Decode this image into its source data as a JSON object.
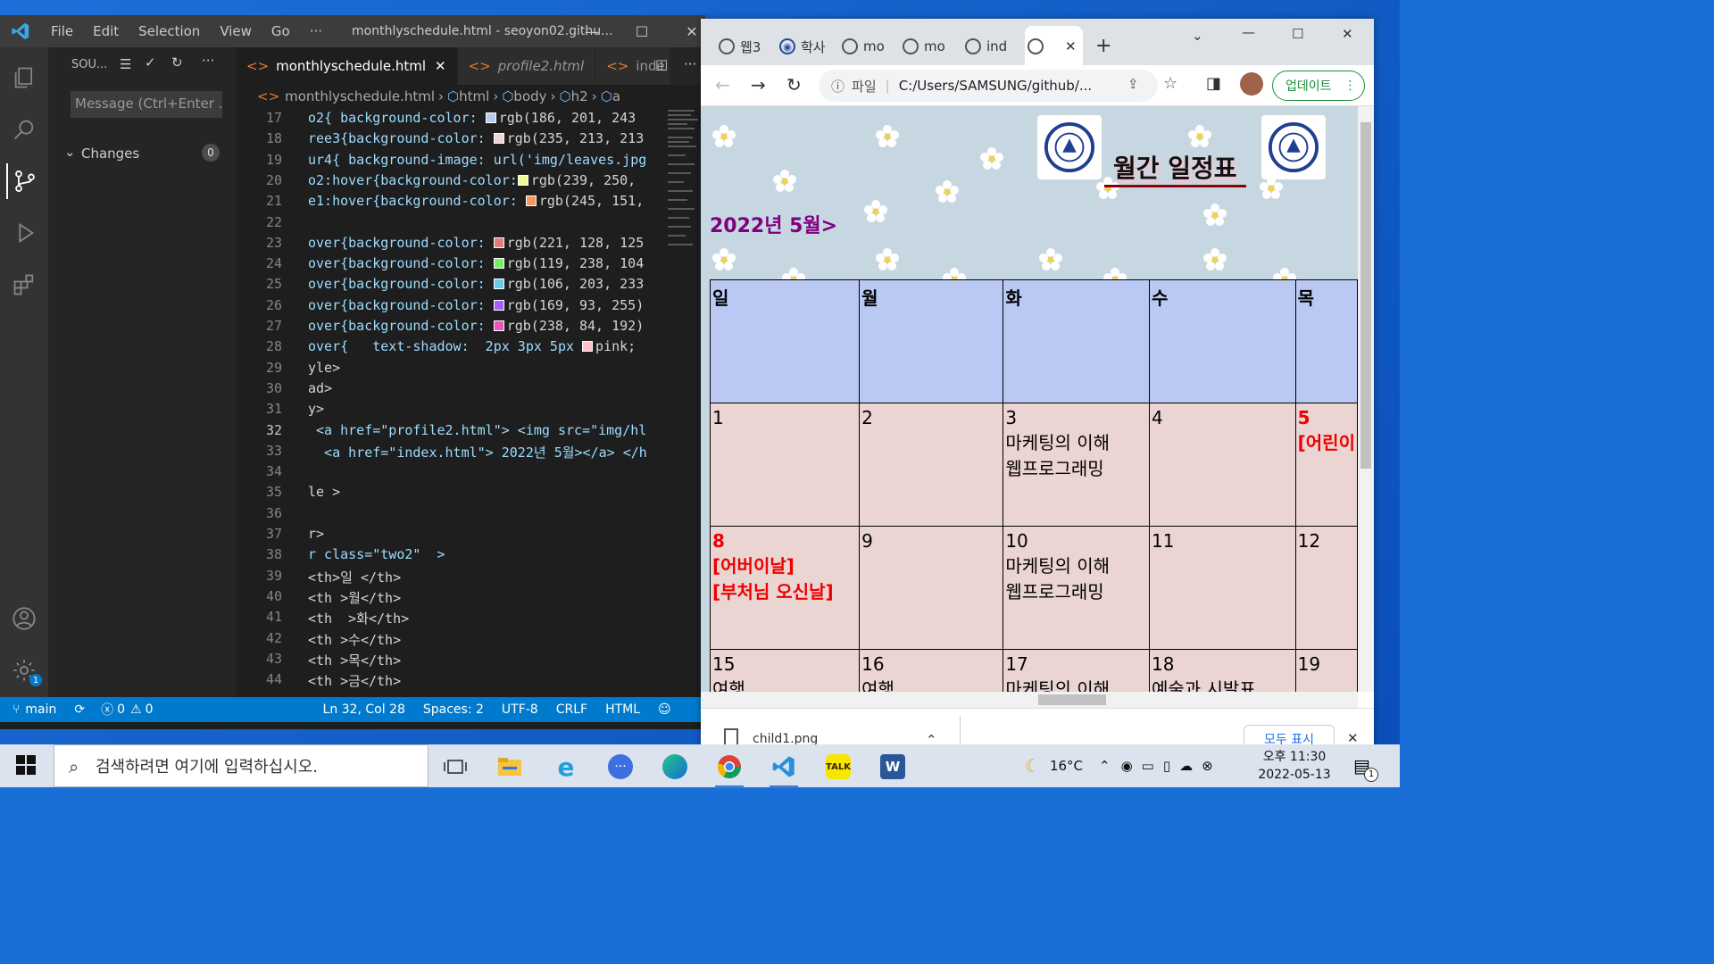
{
  "vscode": {
    "menu": [
      "File",
      "Edit",
      "Selection",
      "View",
      "Go",
      "···"
    ],
    "window_title": "monthlyschedule.html - seoyon02.githu...",
    "sidebar": {
      "header": "SOU...",
      "message_placeholder": "Message (Ctrl+Enter ...",
      "changes_label": "Changes",
      "changes_count": "0"
    },
    "tabs": [
      "monthlyschedule.html",
      "profile2.html",
      "inde"
    ],
    "breadcrumb": [
      "monthlyschedule.html",
      "html",
      "body",
      "h2",
      "a"
    ],
    "code_lines": [
      {
        "n": "17",
        "pre": "o2{ background-color: ",
        "swatch": "#bac9f3",
        "post": "rgb(186, 201, 243"
      },
      {
        "n": "18",
        "pre": "ree3{background-color: ",
        "swatch": "#ebd5d5",
        "post": "rgb(235, 213, 213"
      },
      {
        "n": "19",
        "pre": "ur4{ background-image: url('img/leaves.jpg",
        "swatch": "",
        "post": ""
      },
      {
        "n": "20",
        "pre": "o2:hover{background-color:",
        "swatch": "#effa9a",
        "post": "rgb(239, 250,"
      },
      {
        "n": "21",
        "pre": "e1:hover{background-color: ",
        "swatch": "#f59760",
        "post": "rgb(245, 151,"
      },
      {
        "n": "22",
        "pre": "",
        "swatch": "",
        "post": ""
      },
      {
        "n": "23",
        "pre": "over{background-color: ",
        "swatch": "#dd807d",
        "post": "rgb(221, 128, 125"
      },
      {
        "n": "24",
        "pre": "over{background-color: ",
        "swatch": "#77ee68",
        "post": "rgb(119, 238, 104"
      },
      {
        "n": "25",
        "pre": "over{background-color: ",
        "swatch": "#6acbe9",
        "post": "rgb(106, 203, 233"
      },
      {
        "n": "26",
        "pre": "over{background-color: ",
        "swatch": "#a95dff",
        "post": "rgb(169, 93, 255)"
      },
      {
        "n": "27",
        "pre": "over{background-color: ",
        "swatch": "#ee54c0",
        "post": "rgb(238, 84, 192)"
      },
      {
        "n": "28",
        "pre": "over{   text-shadow:  2px 3px 5px ",
        "swatch": "#ffc0cb",
        "post": "pink;"
      },
      {
        "n": "29",
        "pre": "yle>",
        "swatch": "",
        "post": ""
      },
      {
        "n": "30",
        "pre": "ad>",
        "swatch": "",
        "post": ""
      },
      {
        "n": "31",
        "pre": "y>",
        "swatch": "",
        "post": ""
      },
      {
        "n": "32",
        "pre": " <a href=\"profile2.html\"> <img src=\"img/hl",
        "swatch": "",
        "post": ""
      },
      {
        "n": "33",
        "pre": "  <a href=\"index.html\"> 2022년 5월></a> </h",
        "swatch": "",
        "post": ""
      },
      {
        "n": "34",
        "pre": "",
        "swatch": "",
        "post": ""
      },
      {
        "n": "35",
        "pre": "le >",
        "swatch": "",
        "post": ""
      },
      {
        "n": "36",
        "pre": "",
        "swatch": "",
        "post": ""
      },
      {
        "n": "37",
        "pre": "r>",
        "swatch": "",
        "post": ""
      },
      {
        "n": "38",
        "pre": "r class=\"two2\"  >",
        "swatch": "",
        "post": ""
      },
      {
        "n": "39",
        "pre": "<th>일 </th>",
        "swatch": "",
        "post": ""
      },
      {
        "n": "40",
        "pre": "<th >월</th>",
        "swatch": "",
        "post": ""
      },
      {
        "n": "41",
        "pre": "<th  >화</th>",
        "swatch": "",
        "post": ""
      },
      {
        "n": "42",
        "pre": "<th >수</th>",
        "swatch": "",
        "post": ""
      },
      {
        "n": "43",
        "pre": "<th >목</th>",
        "swatch": "",
        "post": ""
      },
      {
        "n": "44",
        "pre": "<th >금</th>",
        "swatch": "",
        "post": ""
      }
    ],
    "current_line": "32",
    "status": {
      "branch": "main",
      "errors": "0",
      "warnings": "0",
      "position": "Ln 32, Col 28",
      "spaces": "Spaces: 2",
      "encoding": "UTF-8",
      "eol": "CRLF",
      "language": "HTML"
    }
  },
  "chrome": {
    "tabs": [
      "웹3",
      "학사",
      "mo",
      "mo",
      "ind",
      ""
    ],
    "address": "C:/Users/SAMSUNG/github/...",
    "address_prefix": "파일",
    "update_label": "업데이트",
    "page": {
      "heading": "월간 일정표",
      "month_link": "2022년 5월>",
      "weekdays": [
        "일",
        "월",
        "화",
        "수",
        "목"
      ],
      "rows": [
        [
          {
            "day": "1",
            "lines": [],
            "red": false
          },
          {
            "day": "2",
            "lines": [],
            "red": false
          },
          {
            "day": "3",
            "lines": [
              "마케팅의 이해",
              "웹프로그래밍"
            ],
            "red": false
          },
          {
            "day": "4",
            "lines": [],
            "red": false
          },
          {
            "day": "5",
            "lines": [
              "[어린이"
            ],
            "red": true
          }
        ],
        [
          {
            "day": "8",
            "lines": [
              "[어버이날]",
              "[부처님 오신날]"
            ],
            "red": true
          },
          {
            "day": "9",
            "lines": [],
            "red": false
          },
          {
            "day": "10",
            "lines": [
              "마케팅의 이해",
              "웹프로그래밍"
            ],
            "red": false
          },
          {
            "day": "11",
            "lines": [],
            "red": false
          },
          {
            "day": "12",
            "lines": [],
            "red": false
          }
        ],
        [
          {
            "day": "15",
            "lines": [
              "여행"
            ],
            "red": false
          },
          {
            "day": "16",
            "lines": [
              "여행"
            ],
            "red": false
          },
          {
            "day": "17",
            "lines": [
              "마케팅의 이해"
            ],
            "red": false
          },
          {
            "day": "18",
            "lines": [
              "예술과 시발표"
            ],
            "red": false
          },
          {
            "day": "19",
            "lines": [],
            "red": false
          }
        ]
      ]
    },
    "download": {
      "file": "child1.png",
      "show_all": "모두 표시"
    }
  },
  "taskbar": {
    "search_placeholder": "검색하려면 여기에 입력하십시오.",
    "weather": "16°C",
    "time": "오후 11:30",
    "date": "2022-05-13",
    "notif_count": "1",
    "kakao_label": "TALK"
  },
  "colors": {
    "vscode_status": "#007acc",
    "header_row": "#bac9f3",
    "day_cell": "#ebd5d3",
    "heading_underline": "#8b0000",
    "month_link": "#800080"
  }
}
